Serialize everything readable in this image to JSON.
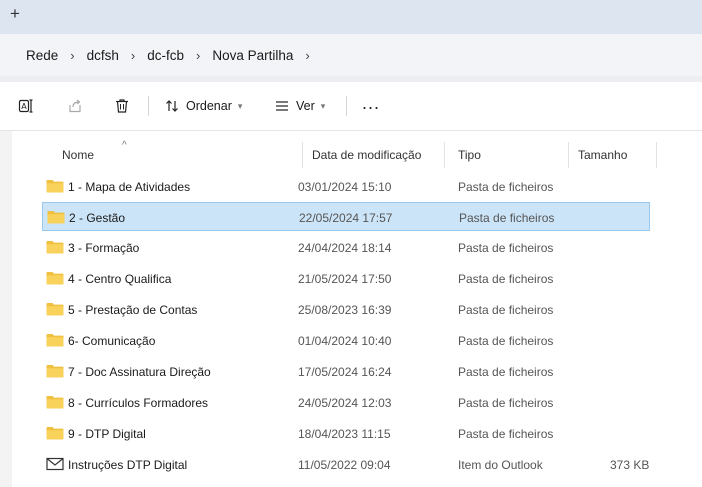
{
  "tabstrip": {
    "add_glyph": "+"
  },
  "breadcrumb": {
    "items": [
      "Rede",
      "dcfsh",
      "dc-fcb",
      "Nova Partilha"
    ],
    "separator": "›"
  },
  "commandbar": {
    "sort_label": "Ordenar",
    "view_label": "Ver",
    "more_label": "..."
  },
  "columns": {
    "name": "Nome",
    "date": "Data de modificação",
    "type": "Tipo",
    "size": "Tamanho"
  },
  "files": [
    {
      "name": "1 - Mapa de Atividades",
      "date": "03/01/2024 15:10",
      "type": "Pasta de ficheiros",
      "size": "",
      "icon": "folder-icon"
    },
    {
      "name": "2 - Gestão",
      "date": "22/05/2024 17:57",
      "type": "Pasta de ficheiros",
      "size": "",
      "icon": "folder-icon",
      "selected": true
    },
    {
      "name": "3 - Formação",
      "date": "24/04/2024 18:14",
      "type": "Pasta de ficheiros",
      "size": "",
      "icon": "folder-icon"
    },
    {
      "name": "4 - Centro Qualifica",
      "date": "21/05/2024 17:50",
      "type": "Pasta de ficheiros",
      "size": "",
      "icon": "folder-icon"
    },
    {
      "name": "5 - Prestação de Contas",
      "date": "25/08/2023 16:39",
      "type": "Pasta de ficheiros",
      "size": "",
      "icon": "folder-icon"
    },
    {
      "name": "6- Comunicação",
      "date": "01/04/2024 10:40",
      "type": "Pasta de ficheiros",
      "size": "",
      "icon": "folder-icon"
    },
    {
      "name": "7 - Doc Assinatura Direção",
      "date": "17/05/2024 16:24",
      "type": "Pasta de ficheiros",
      "size": "",
      "icon": "folder-icon"
    },
    {
      "name": "8 - Currículos Formadores",
      "date": "24/05/2024 12:03",
      "type": "Pasta de ficheiros",
      "size": "",
      "icon": "folder-icon"
    },
    {
      "name": "9 - DTP Digital",
      "date": "18/04/2023 11:15",
      "type": "Pasta de ficheiros",
      "size": "",
      "icon": "folder-icon"
    },
    {
      "name": "Instruções DTP Digital",
      "date": "11/05/2022 09:04",
      "type": "Item do Outlook",
      "size": "373 KB",
      "icon": "mail-icon"
    }
  ],
  "colors": {
    "folder": "#f0c040",
    "selection_bg": "#cce4f7",
    "selection_border": "#99c9ef"
  }
}
